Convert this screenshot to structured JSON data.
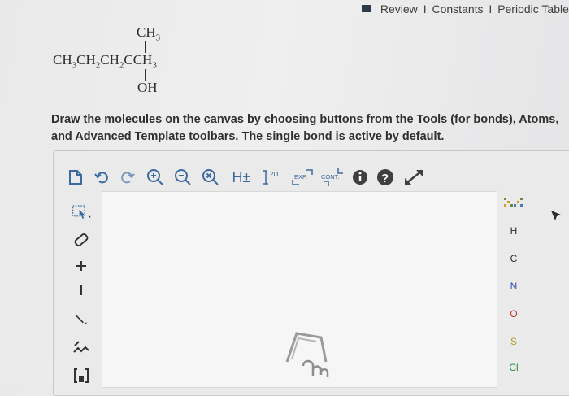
{
  "nav": {
    "review": "Review",
    "sep1": "I",
    "constants": "Constants",
    "sep2": "I",
    "periodic_table": "Periodic Table"
  },
  "formula": {
    "top_group": "CH",
    "top_sub": "3",
    "main_parts": [
      "CH",
      "3",
      "CH",
      "2",
      "CH",
      "2",
      "CCH",
      "3"
    ],
    "bottom_group": "OH"
  },
  "instructions": "Draw the molecules on the canvas by choosing buttons from the Tools (for bonds), Atoms, and Advanced Template toolbars. The single bond is active by default.",
  "toolbar": {
    "hydrogen_label": "H±",
    "label_2d": "2D",
    "label_exp": "EXP.",
    "label_cont": "CONT."
  },
  "atoms": [
    "H",
    "C",
    "N",
    "O",
    "S",
    "Cl"
  ],
  "colors": {
    "accent_blue": "#3a6aa0",
    "nitrogen": "#2b4fb0",
    "oxygen": "#c0392b",
    "sulfur": "#b49a1f",
    "chlorine": "#2e8b3a",
    "dark_icon": "#3f3f3f"
  },
  "left_tools": [
    "select-lasso-icon",
    "eraser-icon",
    "plus-charge-icon",
    "minus-charge-icon",
    "single-bond-icon",
    "chain-icon",
    "bracket-icon"
  ]
}
